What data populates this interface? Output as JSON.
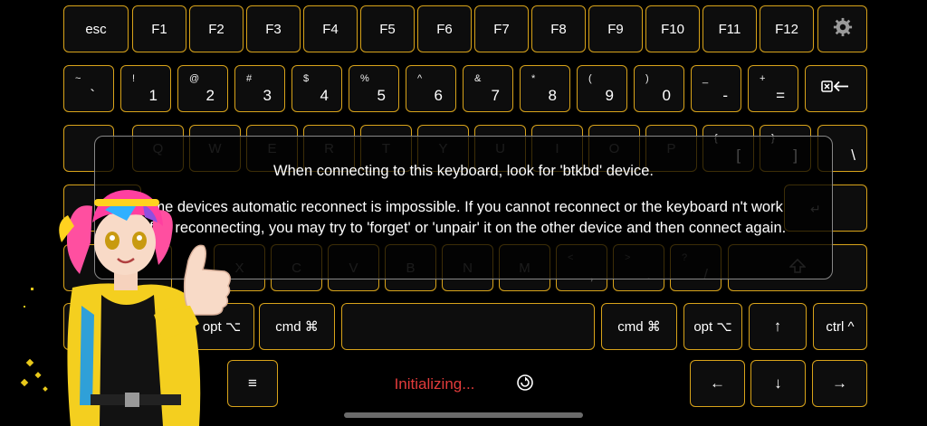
{
  "keys": {
    "esc": "esc",
    "f1": "F1",
    "f2": "F2",
    "f3": "F3",
    "f4": "F4",
    "f5": "F5",
    "f6": "F6",
    "f7": "F7",
    "f8": "F8",
    "f9": "F9",
    "f10": "F10",
    "f11": "F11",
    "f12": "F12",
    "tilde": {
      "shift": "~",
      "main": "`"
    },
    "n1": {
      "shift": "!",
      "main": "1"
    },
    "n2": {
      "shift": "@",
      "main": "2"
    },
    "n3": {
      "shift": "#",
      "main": "3"
    },
    "n4": {
      "shift": "$",
      "main": "4"
    },
    "n5": {
      "shift": "%",
      "main": "5"
    },
    "n6": {
      "shift": "^",
      "main": "6"
    },
    "n7": {
      "shift": "&",
      "main": "7"
    },
    "n8": {
      "shift": "*",
      "main": "8"
    },
    "n9": {
      "shift": "(",
      "main": "9"
    },
    "n0": {
      "shift": ")",
      "main": "0"
    },
    "minus": {
      "shift": "_",
      "main": "-"
    },
    "equal": {
      "shift": "+",
      "main": "="
    },
    "q": "Q",
    "w": "W",
    "e": "E",
    "r": "R",
    "t": "T",
    "y": "Y",
    "u": "U",
    "i": "I",
    "o": "O",
    "p": "P",
    "lbracket": {
      "shift": "{",
      "main": "["
    },
    "rbracket": {
      "shift": "}",
      "main": "]"
    },
    "backslash": "\\",
    "x": "X",
    "c": "C",
    "v": "V",
    "b": "B",
    "n": "N",
    "m": "M",
    "comma": {
      "shift": "<",
      "main": ","
    },
    "period": {
      "shift": ">",
      "main": "."
    },
    "slash": {
      "shift": "?",
      "main": "/"
    },
    "opt_left": "opt ⌥",
    "cmd_left": "cmd ⌘",
    "cmd_right": "cmd ⌘",
    "opt_right": "opt ⌥",
    "ctrl_right": "ctrl ^",
    "arrow_up": "↑",
    "arrow_left": "←",
    "arrow_down": "↓",
    "arrow_right": "→",
    "menu": "≡"
  },
  "overlay": {
    "line1": "When connecting to this keyboard, look for 'btkbd' device.",
    "line2": "ome devices automatic reconnect is impossible. If you cannot reconnect or the keyboard n't work after reconnecting, you may try to 'forget' or 'unpair' it on the other device and then connect again."
  },
  "status": "Initializing...",
  "colors": {
    "key_border": "#d8a31a",
    "status": "#e23b3b",
    "background": "#000000"
  },
  "icons": [
    "gear-icon",
    "backspace-icon",
    "shift-icon",
    "return-icon",
    "reconnect-icon",
    "mascot-illustration"
  ]
}
